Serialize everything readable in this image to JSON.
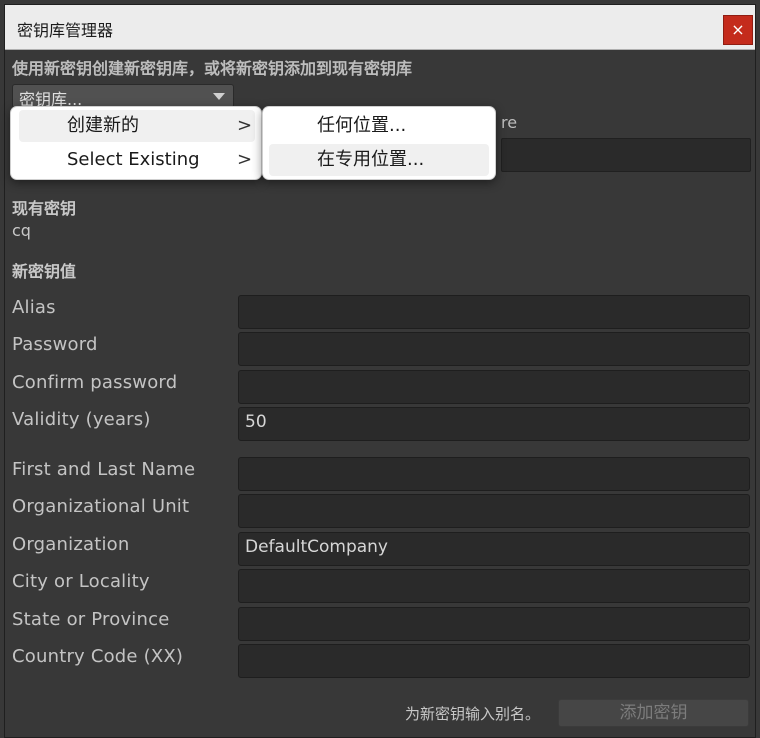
{
  "window": {
    "title": "密钥库管理器",
    "close_glyph": "×"
  },
  "instruction": "使用新密钥创建新密钥库，或将新密钥添加到现有密钥库",
  "keystore_dropdown": {
    "value": "密钥库..."
  },
  "partially_hidden_text": "re",
  "existing_key": {
    "heading": "现有密钥",
    "value": "cq"
  },
  "new_key_heading": "新密钥值",
  "fields": [
    {
      "label": "Alias",
      "value": ""
    },
    {
      "label": "Password",
      "value": ""
    },
    {
      "label": "Confirm password",
      "value": ""
    },
    {
      "label": "Validity (years)",
      "value": "50"
    },
    {
      "label": "First and Last Name",
      "value": ""
    },
    {
      "label": "Organizational Unit",
      "value": ""
    },
    {
      "label": "Organization",
      "value": "DefaultCompany"
    },
    {
      "label": "City or Locality",
      "value": ""
    },
    {
      "label": "State or Province",
      "value": ""
    },
    {
      "label": "Country Code (XX)",
      "value": ""
    }
  ],
  "footer": {
    "hint": "为新密钥输入别名。",
    "add_button": "添加密钥"
  },
  "menu": {
    "items": [
      {
        "label": "创建新的",
        "chevron": ">"
      },
      {
        "label": "Select Existing",
        "chevron": ">"
      }
    ],
    "submenu": [
      {
        "label": "任何位置..."
      },
      {
        "label": "在专用位置..."
      }
    ]
  },
  "colors": {
    "close": "#c42b1c",
    "panel": "#383838",
    "field": "#2a2a2a"
  }
}
